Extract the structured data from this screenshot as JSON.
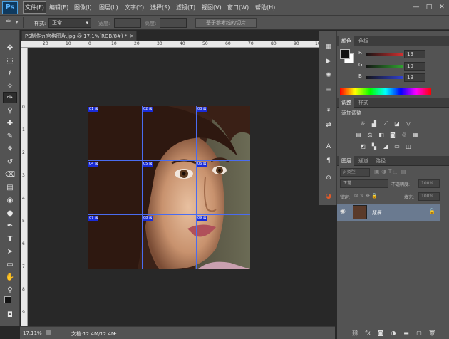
{
  "menubar": {
    "logo": "Ps",
    "items": [
      "文件(F)",
      "编辑(E)",
      "图像(I)",
      "图层(L)",
      "文字(Y)",
      "选择(S)",
      "滤镜(T)",
      "视图(V)",
      "窗口(W)",
      "帮助(H)"
    ],
    "window_controls": [
      "—",
      "□",
      "✕"
    ]
  },
  "optbar": {
    "style_label": "样式:",
    "style_value": "正常",
    "width_label": "宽度:",
    "height_label": "高度:",
    "slice_button": "基于参考线的切片"
  },
  "document": {
    "tab_title": "PS制作九宫格图片.jpg @ 17.1%(RGB/8#) *",
    "tab_close": "✕",
    "ruler_top_labels": [
      "20",
      "10",
      "0",
      "10",
      "20",
      "30",
      "40",
      "50",
      "60",
      "70",
      "80",
      "90",
      "100"
    ],
    "ruler_left_labels": [
      "0",
      "1",
      "2",
      "3",
      "4",
      "5",
      "6",
      "7",
      "8",
      "9"
    ],
    "slices": [
      "01",
      "02",
      "03",
      "04",
      "05",
      "06",
      "07",
      "08",
      "09"
    ]
  },
  "statusbar": {
    "zoom": "17.11%",
    "doc_info": "文档:12.4M/12.4M"
  },
  "color_panel": {
    "tabs": [
      "颜色",
      "色板"
    ],
    "channels": [
      {
        "label": "R",
        "value": "19",
        "color": "#d03030"
      },
      {
        "label": "G",
        "value": "19",
        "color": "#30a030"
      },
      {
        "label": "B",
        "value": "19",
        "color": "#3040d0"
      }
    ]
  },
  "adjust_panel": {
    "tabs": [
      "调整",
      "样式"
    ],
    "title": "添加调整"
  },
  "layers_panel": {
    "tabs": [
      "图层",
      "通道",
      "路径"
    ],
    "filter_label": "ρ 类型",
    "blend_mode": "正常",
    "opacity_label": "不透明度:",
    "opacity_value": "100%",
    "lock_label": "锁定:",
    "fill_label": "填充:",
    "fill_value": "100%",
    "layer_name": "背景"
  }
}
